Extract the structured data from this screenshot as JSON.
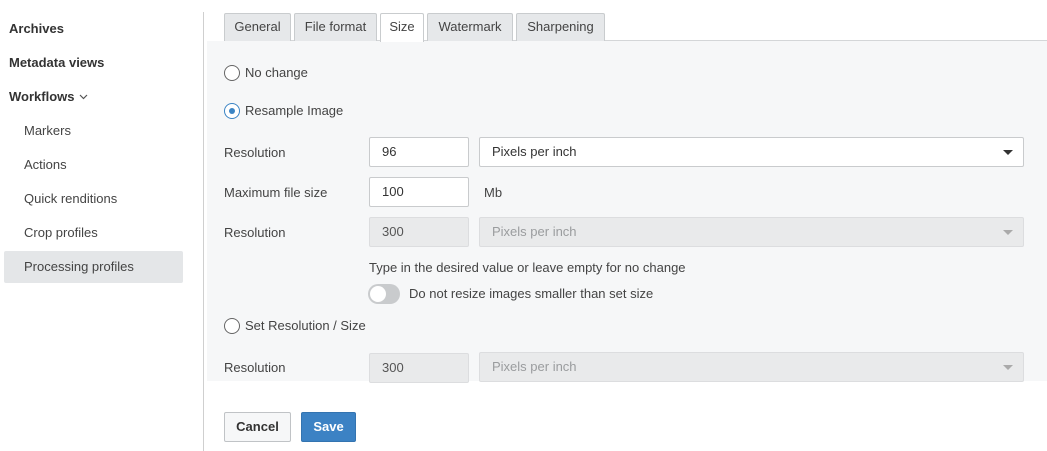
{
  "sidebar": {
    "items": [
      {
        "label": "Archives"
      },
      {
        "label": "Metadata views"
      },
      {
        "label": "Workflows"
      },
      {
        "label": "Markers"
      },
      {
        "label": "Actions"
      },
      {
        "label": "Quick renditions"
      },
      {
        "label": "Crop profiles"
      },
      {
        "label": "Processing profiles"
      }
    ],
    "active_item": "Processing profiles"
  },
  "tabs": [
    {
      "label": "General"
    },
    {
      "label": "File format"
    },
    {
      "label": "Size"
    },
    {
      "label": "Watermark"
    },
    {
      "label": "Sharpening"
    }
  ],
  "active_tab": "Size",
  "size": {
    "no_change_label": "No change",
    "resample_label": "Resample Image",
    "resample_selected": true,
    "resolution_label": "Resolution",
    "resolution_value": "96",
    "resolution_unit": "Pixels per inch",
    "max_file_size_label": "Maximum file size",
    "max_file_size_value": "100",
    "max_file_size_unit": "Mb",
    "resolution2_label": "Resolution",
    "resolution2_value": "300",
    "resolution2_unit": "Pixels per inch",
    "hint": "Type in the desired value or leave empty for no change",
    "toggle_label": "Do not resize images smaller than set size",
    "toggle_on": false,
    "set_resolution_label": "Set Resolution / Size",
    "resolution3_label": "Resolution",
    "resolution3_value": "300",
    "resolution3_unit": "Pixels per inch"
  },
  "buttons": {
    "cancel": "Cancel",
    "save": "Save"
  },
  "colors": {
    "accent": "#3c82c4",
    "active_sidebar_bg": "#e4e6e8"
  }
}
